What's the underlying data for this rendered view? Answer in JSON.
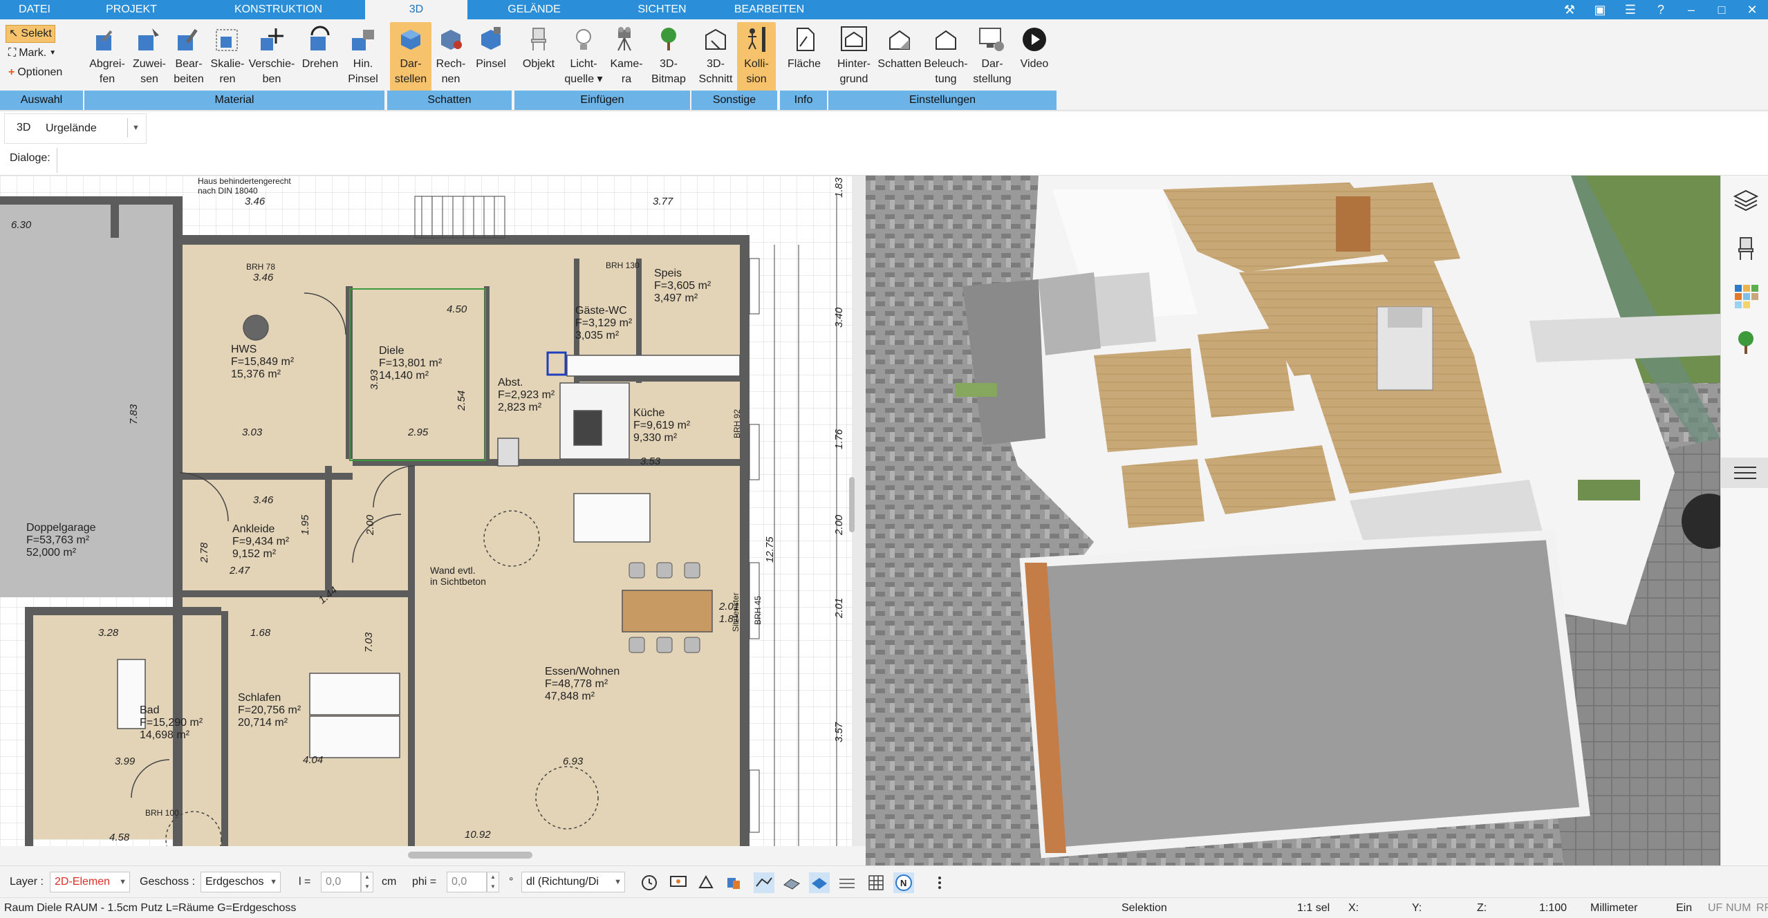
{
  "menu": {
    "tabs": [
      "DATEI",
      "PROJEKT",
      "KONSTRUKTION",
      "3D",
      "GELÄNDE",
      "SICHTEN",
      "BEARBEITEN"
    ],
    "active": "3D"
  },
  "ribbon": {
    "auswahl": {
      "items": [
        "Selekt",
        "Mark.",
        "Optionen"
      ],
      "label": "Auswahl"
    },
    "material": {
      "label": "Material",
      "buttons": [
        {
          "l1": "Abgrei-",
          "l2": "fen"
        },
        {
          "l1": "Zuwei-",
          "l2": "sen"
        },
        {
          "l1": "Bear-",
          "l2": "beiten"
        },
        {
          "l1": "Skalie-",
          "l2": "ren"
        },
        {
          "l1": "Verschie-",
          "l2": "ben"
        },
        {
          "l1": "Drehen",
          "l2": ""
        },
        {
          "l1": "Hin.",
          "l2": "Pinsel"
        }
      ]
    },
    "schatten": {
      "label": "Schatten",
      "buttons": [
        {
          "l1": "Dar-",
          "l2": "stellen"
        },
        {
          "l1": "Rech-",
          "l2": "nen"
        },
        {
          "l1": "Pinsel",
          "l2": ""
        }
      ]
    },
    "einfuegen": {
      "label": "Einfügen",
      "buttons": [
        {
          "l1": "Objekt",
          "l2": ""
        },
        {
          "l1": "Licht-",
          "l2": "quelle ▾"
        },
        {
          "l1": "Kame-",
          "l2": "ra"
        },
        {
          "l1": "3D-",
          "l2": "Bitmap"
        }
      ]
    },
    "sonstige": {
      "label": "Sonstige",
      "buttons": [
        {
          "l1": "3D-",
          "l2": "Schnitt"
        },
        {
          "l1": "Kolli-",
          "l2": "sion"
        }
      ]
    },
    "info": {
      "label": "Info",
      "buttons": [
        {
          "l1": "Fläche",
          "l2": ""
        }
      ]
    },
    "einstellungen": {
      "label": "Einstellungen",
      "buttons": [
        {
          "l1": "Hinter-",
          "l2": "grund"
        },
        {
          "l1": "Schatten",
          "l2": ""
        },
        {
          "l1": "Beleuch-",
          "l2": "tung"
        },
        {
          "l1": "Dar-",
          "l2": "stellung"
        },
        {
          "l1": "Video",
          "l2": ""
        }
      ]
    }
  },
  "selector": {
    "mode": "3D",
    "value": "Urgelände"
  },
  "dialog": {
    "label": "Dialoge:"
  },
  "plan": {
    "rooms": [
      {
        "name": "HWS",
        "f1": "F=15,849 m²",
        "f2": "15,376 m²"
      },
      {
        "name": "Diele",
        "f1": "F=13,801 m²",
        "f2": "14,140 m²"
      },
      {
        "name": "Speis",
        "f1": "F=3,605 m²",
        "f2": "3,497 m²"
      },
      {
        "name": "Gäste-WC",
        "f1": "F=3,129 m²",
        "f2": "3,035 m²"
      },
      {
        "name": "Abst.",
        "f1": "F=2,923 m²",
        "f2": "2,823 m²"
      },
      {
        "name": "Küche",
        "f1": "F=9,619 m²",
        "f2": "9,330 m²"
      },
      {
        "name": "Ankleide",
        "f1": "F=9,434 m²",
        "f2": "9,152 m²"
      },
      {
        "name": "Doppelgarage",
        "f1": "F=53,763 m²",
        "f2": "52,000 m²"
      },
      {
        "name": "Bad",
        "f1": "F=15,290 m²",
        "f2": "14,698 m²"
      },
      {
        "name": "Schlafen",
        "f1": "F=20,756 m²",
        "f2": "20,714 m²"
      },
      {
        "name": "Essen/Wohnen",
        "f1": "F=48,778 m²",
        "f2": "47,848 m²"
      }
    ],
    "dims": [
      "6.30",
      "3.46",
      "3.77",
      "4.50",
      "3.46",
      "3.03",
      "2.95",
      "3.53",
      "3.46",
      "2.47",
      "1.68",
      "3.28",
      "4.04",
      "3.99",
      "6.93",
      "10.92",
      "4.58",
      "1.83",
      "3.40",
      "1.76",
      "2.00",
      "2.01",
      "3.57",
      "7.83",
      "7.03",
      "12.75",
      "2.78",
      "1.95",
      "1.44",
      "2.00",
      "3.93",
      "2.54",
      "1.81",
      "2.01"
    ],
    "notes": [
      "Haus behindertengerecht",
      "nach DIN 18040",
      "Wand evtl.",
      "in Sichtbeton",
      "BRH 78",
      "BRH 100",
      "BRH 130",
      "BRH 92",
      "BRH 45",
      "Sitzfenster"
    ]
  },
  "bottombar": {
    "layer_label": "Layer :",
    "layer_value": "2D-Elemen",
    "geschoss_label": "Geschoss :",
    "geschoss_value": "Erdgeschos",
    "l_label": "l =",
    "l_value": "0,0",
    "cm": "cm",
    "phi_label": "phi =",
    "phi_value": "0,0",
    "deg": "°",
    "dl_value": "dl (Richtung/Di"
  },
  "status": {
    "left": "Raum Diele RAUM - 1.5cm Putz L=Räume G=Erdgeschoss",
    "mode": "Selektion",
    "sel": "1:1 sel",
    "x": "X:",
    "y": "Y:",
    "z": "Z:",
    "scale": "1:100",
    "unit": "Millimeter",
    "ein": "Ein",
    "uf": "UF",
    "num": "NUM",
    "rf": "RF"
  },
  "colors": {
    "menubar": "#2a8fd8",
    "ribbon_group": "#6cb4e8",
    "highlight": "#f6c26b",
    "plan_room": "#e6d6bd",
    "floor3d": "#c9a877"
  }
}
